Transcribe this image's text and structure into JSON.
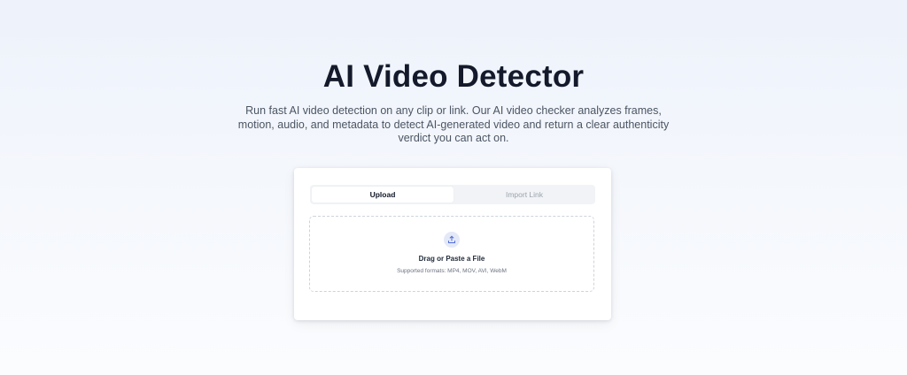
{
  "hero": {
    "title": "AI Video Detector",
    "subtitle": "Run fast AI video detection on any clip or link. Our AI video checker analyzes frames, motion, audio, and metadata to detect AI-generated video and return a clear authenticity verdict you can act on."
  },
  "tabs": [
    {
      "label": "Upload",
      "active": true
    },
    {
      "label": "Import Link",
      "active": false
    }
  ],
  "dropzone": {
    "icon": "upload-icon",
    "title": "Drag or Paste a File",
    "formats": "Supported formats: MP4, MOV, AVI, WebM"
  },
  "colors": {
    "accent_icon_bg": "#e4e9f8",
    "accent_icon": "#4f6bd8",
    "title": "#141a2b",
    "text_muted": "#4b5563"
  }
}
